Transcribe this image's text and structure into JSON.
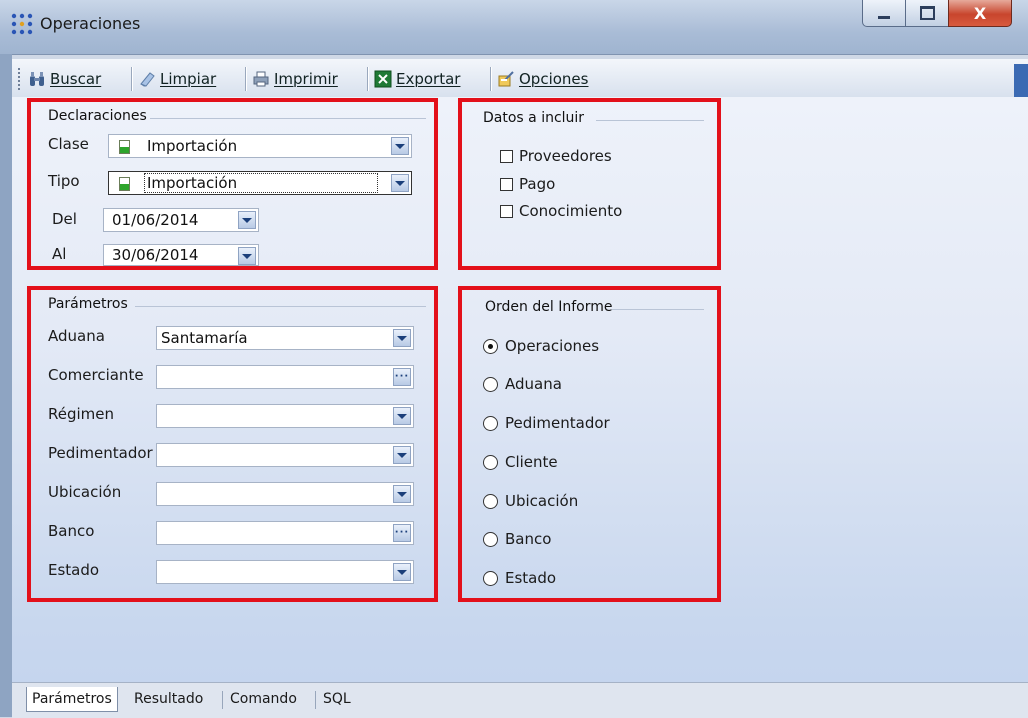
{
  "window": {
    "title": "Operaciones",
    "close_glyph": "X"
  },
  "toolbar": {
    "items": [
      {
        "label": "Buscar",
        "icon": "binoculars-icon"
      },
      {
        "label": "Limpiar",
        "icon": "eraser-icon"
      },
      {
        "label": "Imprimir",
        "icon": "printer-icon"
      },
      {
        "label": "Exportar",
        "icon": "excel-icon"
      },
      {
        "label": "Opciones",
        "icon": "options-icon"
      }
    ]
  },
  "declaraciones": {
    "title": "Declaraciones",
    "clase": {
      "label": "Clase",
      "value": "Importación"
    },
    "tipo": {
      "label": "Tipo",
      "value": "Importación"
    },
    "del": {
      "label": "Del",
      "value": "01/06/2014"
    },
    "al": {
      "label": "Al",
      "value": "30/06/2014"
    }
  },
  "datos_incluir": {
    "title": "Datos a incluir",
    "options": [
      {
        "label": "Proveedores",
        "checked": false
      },
      {
        "label": "Pago",
        "checked": false
      },
      {
        "label": "Conocimiento",
        "checked": false
      }
    ]
  },
  "parametros": {
    "title": "Parámetros",
    "fields": [
      {
        "label": "Aduana",
        "value": "Santamaría",
        "button": "dropdown"
      },
      {
        "label": "Comerciante",
        "value": "",
        "button": "ellipsis"
      },
      {
        "label": "Régimen",
        "value": "",
        "button": "dropdown"
      },
      {
        "label": "Pedimentador",
        "value": "",
        "button": "dropdown"
      },
      {
        "label": "Ubicación",
        "value": "",
        "button": "dropdown"
      },
      {
        "label": "Banco",
        "value": "",
        "button": "ellipsis"
      },
      {
        "label": "Estado",
        "value": "",
        "button": "dropdown"
      }
    ],
    "ellipsis_glyph": "···"
  },
  "orden": {
    "title": "Orden del Informe",
    "selected": "Operaciones",
    "options": [
      "Operaciones",
      "Aduana",
      "Pedimentador",
      "Cliente",
      "Ubicación",
      "Banco",
      "Estado"
    ]
  },
  "tabs": {
    "items": [
      "Parámetros",
      "Resultado",
      "Comando",
      "SQL"
    ],
    "active": "Parámetros"
  },
  "colors": {
    "highlight_border": "#e3101a",
    "accent": "#1b3f7a"
  }
}
